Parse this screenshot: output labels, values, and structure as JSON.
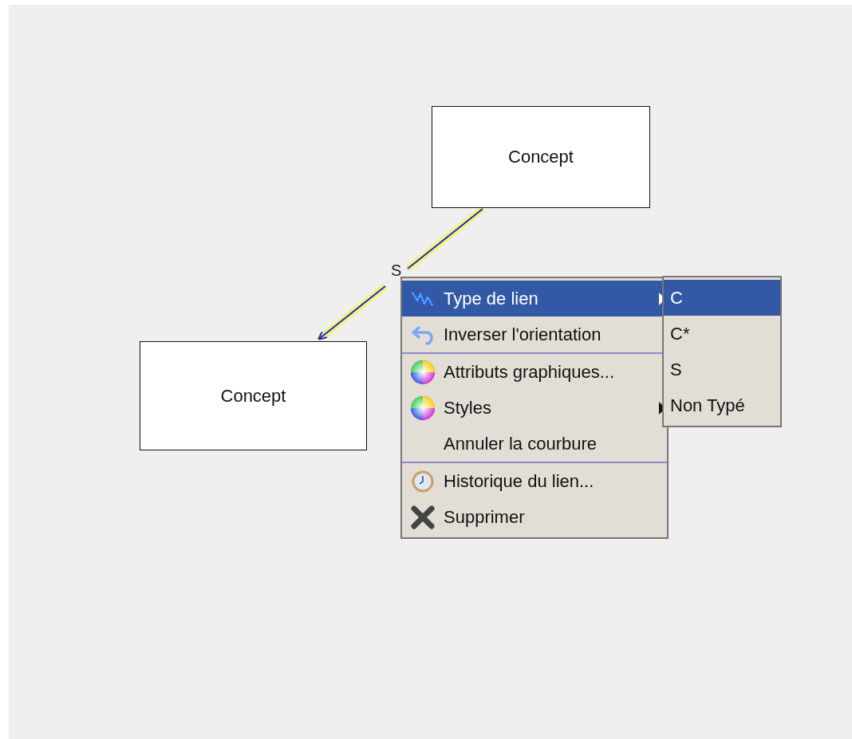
{
  "nodes": [
    {
      "label": "Concept"
    },
    {
      "label": "Concept"
    }
  ],
  "link": {
    "label": "S",
    "selected": true
  },
  "context_menu": {
    "items": [
      {
        "label": "Type de lien",
        "selected": true,
        "submenu": true,
        "separator_before": false
      },
      {
        "label": "Inverser l'orientation",
        "selected": false,
        "submenu": false,
        "separator_before": false
      },
      {
        "label": "Attributs graphiques...",
        "selected": false,
        "submenu": false,
        "separator_before": true
      },
      {
        "label": "Styles",
        "selected": false,
        "submenu": true,
        "separator_before": false
      },
      {
        "label": "Annuler la courbure",
        "selected": false,
        "submenu": false,
        "separator_before": false
      },
      {
        "label": "Historique du lien...",
        "selected": false,
        "submenu": false,
        "separator_before": true
      },
      {
        "label": "Supprimer",
        "selected": false,
        "submenu": false,
        "separator_before": false
      }
    ]
  },
  "submenu": {
    "items": [
      {
        "label": "C",
        "selected": true
      },
      {
        "label": "C*",
        "selected": false
      },
      {
        "label": "S",
        "selected": false
      },
      {
        "label": "Non Typé",
        "selected": false
      }
    ]
  }
}
